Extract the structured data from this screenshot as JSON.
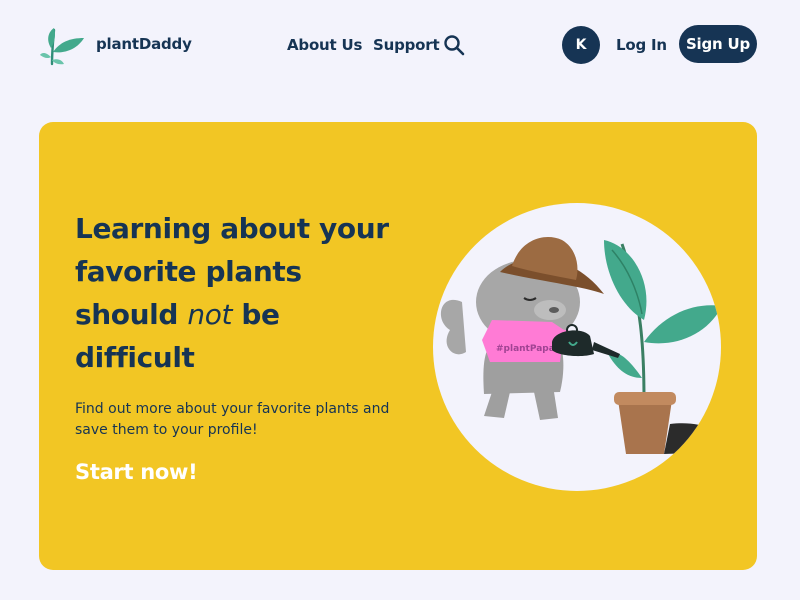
{
  "header": {
    "brand_name": "plantDaddy",
    "nav": {
      "about_label": "About Us",
      "support_label": "Support"
    },
    "avatar_initial": "K",
    "login_label": "Log In",
    "signup_label": "Sign Up"
  },
  "hero": {
    "title_part1": "Learning about your favorite plants should",
    "title_emphasis": "not",
    "title_part2": "be difficult",
    "description": "Find out more about your favorite plants and save them to your profile!",
    "cta_label": "Start now!",
    "shirt_text": "#plantPapa"
  },
  "colors": {
    "page_background": "#f3f3fc",
    "navy": "#163454",
    "hero_yellow": "#f2c624",
    "leaf_green": "#43a98c",
    "shirt_pink": "#ff7bd5",
    "hat_brown": "#9c6b42",
    "pot_brown": "#a9744d"
  },
  "icons": [
    "logo-sprout-icon",
    "search-icon"
  ]
}
